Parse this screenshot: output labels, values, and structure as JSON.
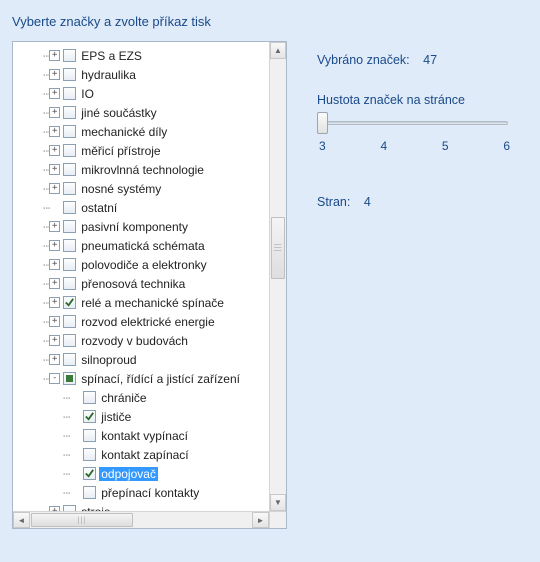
{
  "title": "Vyberte značky a zvolte příkaz tisk",
  "tree": [
    {
      "level": 0,
      "expander": "+",
      "check": "none",
      "label": "EPS a EZS"
    },
    {
      "level": 0,
      "expander": "+",
      "check": "none",
      "label": "hydraulika"
    },
    {
      "level": 0,
      "expander": "+",
      "check": "none",
      "label": "IO"
    },
    {
      "level": 0,
      "expander": "+",
      "check": "none",
      "label": "jiné součástky"
    },
    {
      "level": 0,
      "expander": "+",
      "check": "none",
      "label": "mechanické díly"
    },
    {
      "level": 0,
      "expander": "+",
      "check": "none",
      "label": "měřicí přístroje"
    },
    {
      "level": 0,
      "expander": "+",
      "check": "none",
      "label": "mikrovlnná technologie"
    },
    {
      "level": 0,
      "expander": "+",
      "check": "none",
      "label": "nosné systémy"
    },
    {
      "level": 0,
      "expander": "",
      "check": "none",
      "label": "ostatní"
    },
    {
      "level": 0,
      "expander": "+",
      "check": "none",
      "label": "pasivní komponenty"
    },
    {
      "level": 0,
      "expander": "+",
      "check": "none",
      "label": "pneumatická schémata"
    },
    {
      "level": 0,
      "expander": "+",
      "check": "none",
      "label": "polovodiče a elektronky"
    },
    {
      "level": 0,
      "expander": "+",
      "check": "none",
      "label": "přenosová technika"
    },
    {
      "level": 0,
      "expander": "+",
      "check": "checked",
      "label": "relé a mechanické spínače"
    },
    {
      "level": 0,
      "expander": "+",
      "check": "none",
      "label": "rozvod elektrické energie"
    },
    {
      "level": 0,
      "expander": "+",
      "check": "none",
      "label": "rozvody v budovách"
    },
    {
      "level": 0,
      "expander": "+",
      "check": "none",
      "label": "silnoproud"
    },
    {
      "level": 0,
      "expander": "-",
      "check": "mixed",
      "label": "spínací, řídící a jistící zařízení"
    },
    {
      "level": 1,
      "expander": "",
      "check": "none",
      "label": "chrániče"
    },
    {
      "level": 1,
      "expander": "",
      "check": "checked",
      "label": "jističe"
    },
    {
      "level": 1,
      "expander": "",
      "check": "none",
      "label": "kontakt vypínací"
    },
    {
      "level": 1,
      "expander": "",
      "check": "none",
      "label": "kontakt zapínací"
    },
    {
      "level": 1,
      "expander": "",
      "check": "checked",
      "label": "odpojovač",
      "selected": true
    },
    {
      "level": 1,
      "expander": "",
      "check": "none",
      "label": "přepínací kontakty"
    },
    {
      "level": 0,
      "expander": "+",
      "check": "none",
      "label": "stroje"
    }
  ],
  "info": {
    "selected_label": "Vybráno značek:",
    "selected_value": "47",
    "density_label": "Hustota značek na stránce",
    "pages_label": "Stran:",
    "pages_value": "4"
  },
  "slider": {
    "ticks": [
      "3",
      "4",
      "5",
      "6"
    ],
    "value_index": 0
  }
}
